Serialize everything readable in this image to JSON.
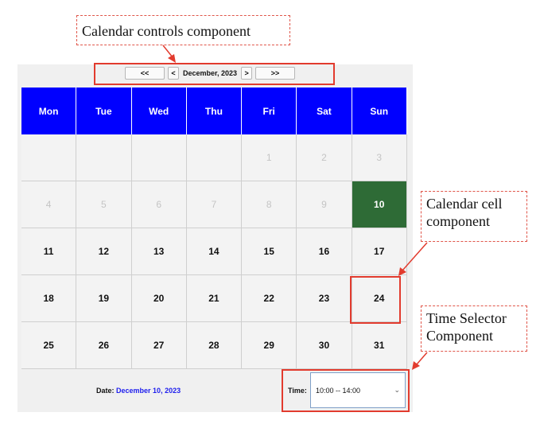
{
  "callouts": {
    "controls": "Calendar controls component",
    "cell": [
      "Calendar cell",
      "component"
    ],
    "time": [
      "Time Selector",
      "Component"
    ]
  },
  "controls": {
    "prev_year": "<<",
    "prev_month": "<",
    "month_label": "December, 2023",
    "next_month": ">",
    "next_year": ">>"
  },
  "weekdays": [
    "Mon",
    "Tue",
    "Wed",
    "Thu",
    "Fri",
    "Sat",
    "Sun"
  ],
  "weeks": [
    [
      {
        "d": ""
      },
      {
        "d": ""
      },
      {
        "d": ""
      },
      {
        "d": ""
      },
      {
        "d": "1",
        "state": "disabled"
      },
      {
        "d": "2",
        "state": "disabled"
      },
      {
        "d": "3",
        "state": "disabled"
      }
    ],
    [
      {
        "d": "4",
        "state": "disabled"
      },
      {
        "d": "5",
        "state": "disabled"
      },
      {
        "d": "6",
        "state": "disabled"
      },
      {
        "d": "7",
        "state": "disabled"
      },
      {
        "d": "8",
        "state": "disabled"
      },
      {
        "d": "9",
        "state": "disabled"
      },
      {
        "d": "10",
        "state": "selected"
      }
    ],
    [
      {
        "d": "11"
      },
      {
        "d": "12"
      },
      {
        "d": "13"
      },
      {
        "d": "14"
      },
      {
        "d": "15"
      },
      {
        "d": "16"
      },
      {
        "d": "17"
      }
    ],
    [
      {
        "d": "18"
      },
      {
        "d": "19"
      },
      {
        "d": "20"
      },
      {
        "d": "21"
      },
      {
        "d": "22"
      },
      {
        "d": "23"
      },
      {
        "d": "24"
      }
    ],
    [
      {
        "d": "25"
      },
      {
        "d": "26"
      },
      {
        "d": "27"
      },
      {
        "d": "28"
      },
      {
        "d": "29"
      },
      {
        "d": "30"
      },
      {
        "d": "31"
      }
    ]
  ],
  "footer": {
    "date_label": "Date:",
    "date_value": "December 10, 2023",
    "time_label": "Time:",
    "time_value": "10:00  --  14:00"
  },
  "colors": {
    "header_bg": "#0000ff",
    "selected_bg": "#2e6b36",
    "annotation": "#e23b2e",
    "date_value": "#2020ee"
  }
}
